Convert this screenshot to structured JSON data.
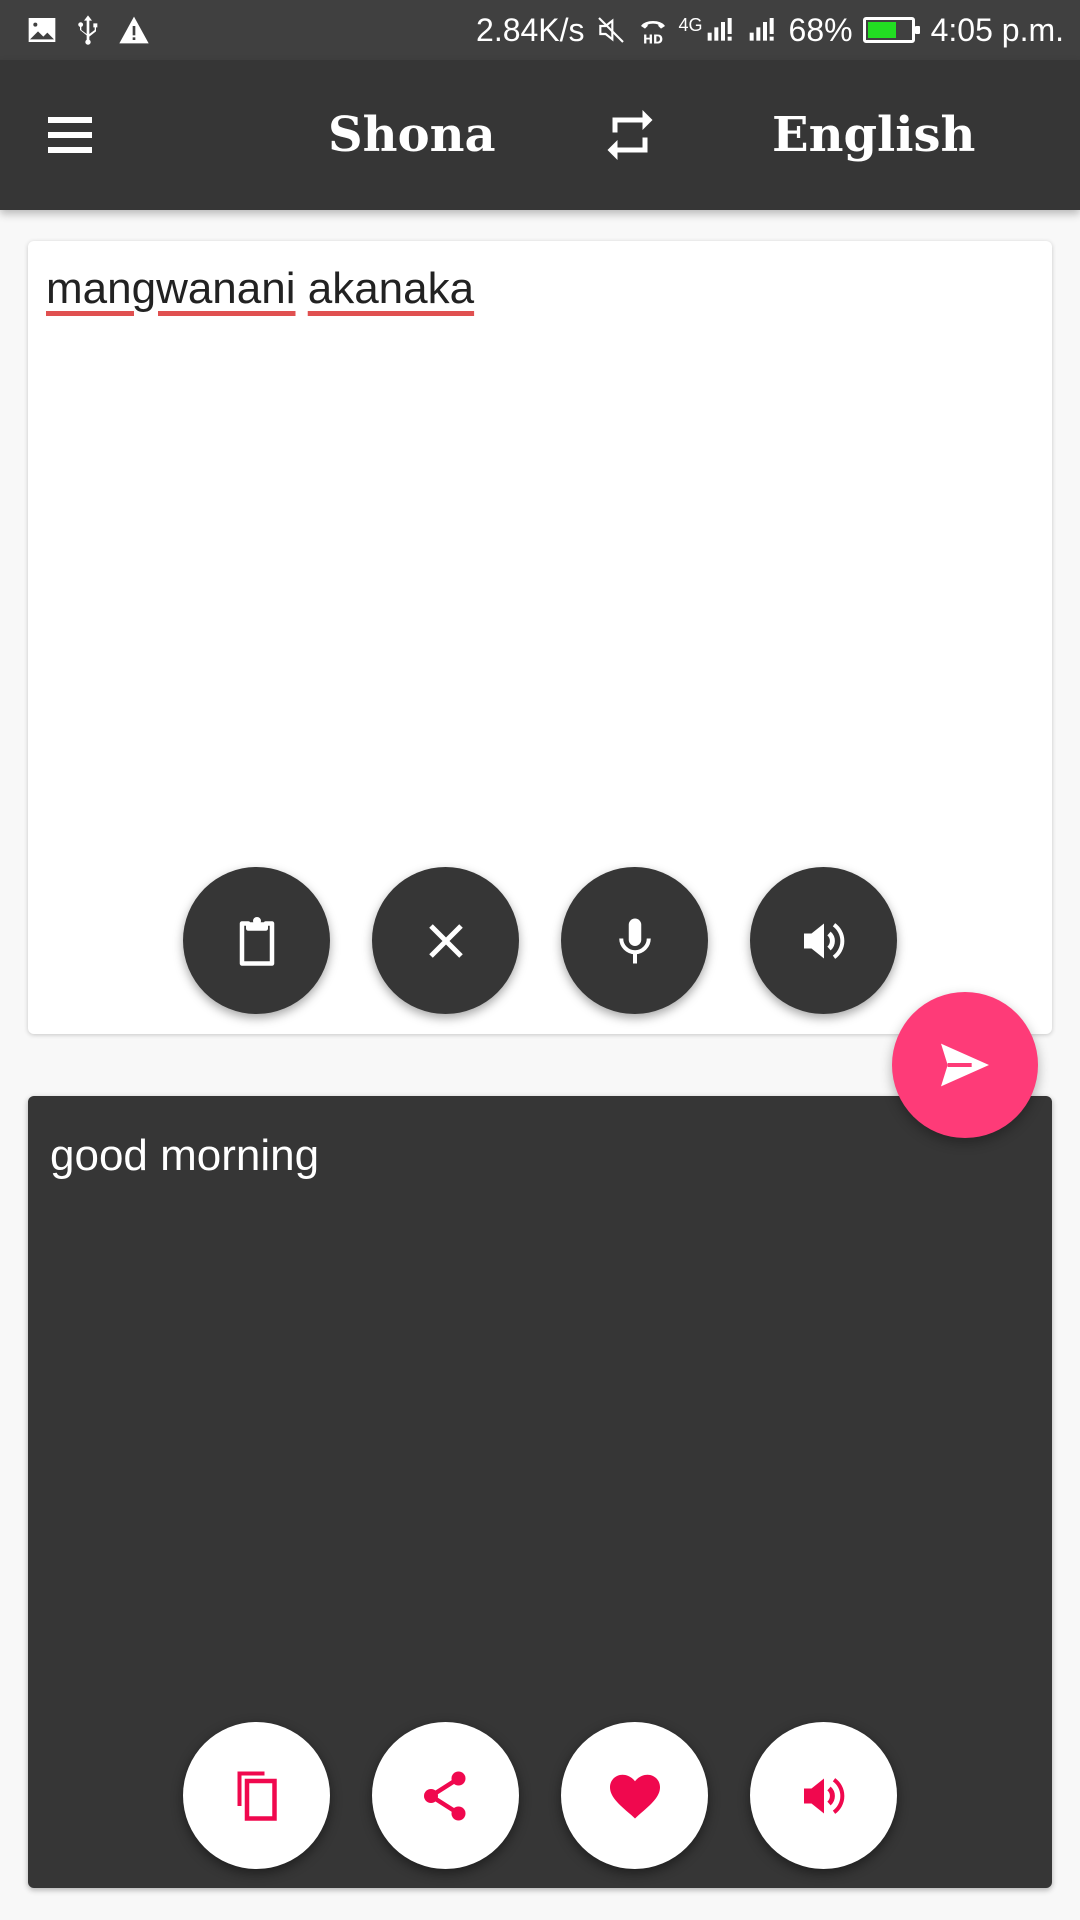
{
  "status_bar": {
    "left_icons": [
      "image-notification-icon",
      "usb-icon",
      "warning-icon"
    ],
    "network_speed": "2.84K/s",
    "right_icons": [
      "mute-icon",
      "hd-voice-icon",
      "signal-4g-icon",
      "signal-sim2-icon"
    ],
    "network_type": "4G",
    "battery_percent_text": "68%",
    "battery_level": 0.68,
    "time": "4:05 p.m."
  },
  "app_bar": {
    "menu_icon": "hamburger-menu-icon",
    "source_language": "Shona",
    "swap_icon": "swap-languages-icon",
    "target_language": "English"
  },
  "input_card": {
    "words": [
      "mangwanani",
      "akanaka"
    ],
    "text": "mangwanani akanaka",
    "misspelled": true,
    "buttons": [
      {
        "name": "paste",
        "icon": "clipboard-icon"
      },
      {
        "name": "clear",
        "icon": "close-icon"
      },
      {
        "name": "voice-input",
        "icon": "microphone-icon"
      },
      {
        "name": "speak-input",
        "icon": "speaker-icon"
      }
    ]
  },
  "translate_fab": {
    "icon": "send-icon"
  },
  "output_card": {
    "text": "good morning",
    "buttons": [
      {
        "name": "copy",
        "icon": "copy-icon"
      },
      {
        "name": "share",
        "icon": "share-icon"
      },
      {
        "name": "favorite",
        "icon": "heart-icon"
      },
      {
        "name": "speak-output",
        "icon": "speaker-icon"
      }
    ]
  },
  "colors": {
    "app_bar": "#363636",
    "status_bar": "#404040",
    "accent": "#fe3b78",
    "output_icon": "#f0084e",
    "battery_fill": "#22dd22",
    "spell_underline": "#e05050",
    "background": "#f8f8f8"
  }
}
